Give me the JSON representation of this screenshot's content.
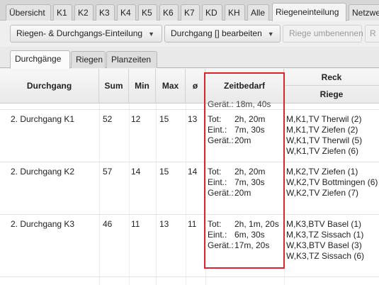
{
  "top_tabs": [
    "Übersicht",
    "K1",
    "K2",
    "K3",
    "K4",
    "K5",
    "K6",
    "K7",
    "KD",
    "KH",
    "Alle",
    "Riegeneinteilung",
    "Netzwe"
  ],
  "toolbar": {
    "riegen_dropdown": "Riegen- & Durchgangs-Einteilung",
    "durchgang_dropdown": "Durchgang [] bearbeiten",
    "riege_umbenennen": "Riege umbenennen",
    "r_button": "R"
  },
  "sub_tabs": [
    "Durchgänge",
    "Riegen",
    "Planzeiten"
  ],
  "table": {
    "headers": {
      "durchgang": "Durchgang",
      "sum": "Sum",
      "min": "Min",
      "max": "Max",
      "avg": "ø",
      "zeitbedarf": "Zeitbedarf",
      "reck": "Reck",
      "riege": "Riege"
    },
    "partial_top_zeit": "Gerät.: 18m, 40s",
    "rows": [
      {
        "durchgang": "2. Durchgang K1",
        "sum": "52",
        "min": "12",
        "max": "15",
        "avg": "13",
        "zeit": [
          {
            "k": "Tot:",
            "v": "2h, 20m"
          },
          {
            "k": "Eint.:",
            "v": "7m, 30s"
          },
          {
            "k": "Gerät.:",
            "v": "20m"
          }
        ],
        "riegen": [
          "M,K1,TV Therwil (2)",
          "M,K1,TV Ziefen (2)",
          "W,K1,TV Therwil (5)",
          "W,K1,TV Ziefen (6)"
        ]
      },
      {
        "durchgang": "2. Durchgang K2",
        "sum": "57",
        "min": "14",
        "max": "15",
        "avg": "14",
        "zeit": [
          {
            "k": "Tot:",
            "v": "2h, 20m"
          },
          {
            "k": "Eint.:",
            "v": "7m, 30s"
          },
          {
            "k": "Gerät.:",
            "v": "20m"
          }
        ],
        "riegen": [
          "M,K2,TV Ziefen (1)",
          "W,K2,TV Bottmingen (6)",
          "W,K2,TV Ziefen (7)"
        ]
      },
      {
        "durchgang": "2. Durchgang K3",
        "sum": "46",
        "min": "11",
        "max": "13",
        "avg": "11",
        "zeit": [
          {
            "k": "Tot:",
            "v": "2h, 1m, 20s"
          },
          {
            "k": "Eint.:",
            "v": "6m, 30s"
          },
          {
            "k": "Gerät.:",
            "v": "17m, 20s"
          }
        ],
        "riegen": [
          "M,K3,BTV Basel (1)",
          "M,K3,TZ Sissach (1)",
          "W,K3,BTV Basel (3)",
          "W,K3,TZ Sissach (6)"
        ]
      }
    ]
  },
  "colors": {
    "highlight": "#d9262c"
  }
}
